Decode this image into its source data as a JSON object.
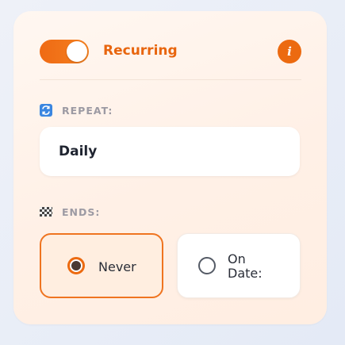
{
  "recurring": {
    "label": "Recurring",
    "enabled": true,
    "info_glyph": "i"
  },
  "repeat": {
    "label": "REPEAT:",
    "icon": "repeat-icon",
    "value": "Daily"
  },
  "ends": {
    "label": "ENDS:",
    "icon": "checkered-flag-icon",
    "options": [
      {
        "label": "Never",
        "selected": true
      },
      {
        "label": "On Date:",
        "selected": false
      }
    ]
  },
  "colors": {
    "accent": "#ec6a10",
    "card_bg": "#fff3ea",
    "section_label": "#9c9aa3"
  }
}
